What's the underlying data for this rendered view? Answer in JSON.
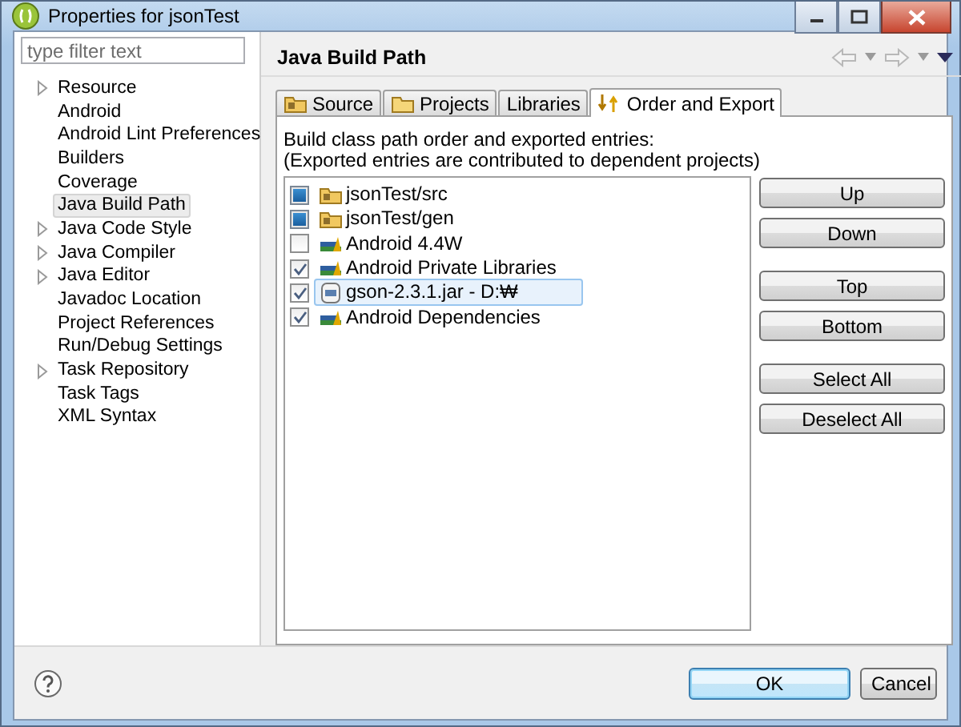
{
  "window": {
    "title": "Properties for jsonTest"
  },
  "filter": {
    "placeholder": "type filter text"
  },
  "tree": [
    {
      "label": "Resource",
      "has_children": true,
      "selected": false
    },
    {
      "label": "Android",
      "has_children": false,
      "selected": false
    },
    {
      "label": "Android Lint Preferences",
      "has_children": false,
      "selected": false
    },
    {
      "label": "Builders",
      "has_children": false,
      "selected": false
    },
    {
      "label": "Coverage",
      "has_children": false,
      "selected": false
    },
    {
      "label": "Java Build Path",
      "has_children": false,
      "selected": true
    },
    {
      "label": "Java Code Style",
      "has_children": true,
      "selected": false
    },
    {
      "label": "Java Compiler",
      "has_children": true,
      "selected": false
    },
    {
      "label": "Java Editor",
      "has_children": true,
      "selected": false
    },
    {
      "label": "Javadoc Location",
      "has_children": false,
      "selected": false
    },
    {
      "label": "Project References",
      "has_children": false,
      "selected": false
    },
    {
      "label": "Run/Debug Settings",
      "has_children": false,
      "selected": false
    },
    {
      "label": "Task Repository",
      "has_children": true,
      "selected": false
    },
    {
      "label": "Task Tags",
      "has_children": false,
      "selected": false
    },
    {
      "label": "XML Syntax",
      "has_children": false,
      "selected": false
    }
  ],
  "page": {
    "title": "Java Build Path"
  },
  "tabs": [
    {
      "label": "Source",
      "kind": "source",
      "selected": false
    },
    {
      "label": "Projects",
      "kind": "projects",
      "selected": false
    },
    {
      "label": "Libraries",
      "kind": "libraries",
      "selected": false
    },
    {
      "label": "Order and Export",
      "kind": "order",
      "selected": true
    }
  ],
  "description": [
    "Build class path order and exported entries:",
    "(Exported entries are contributed to dependent projects)"
  ],
  "entries": [
    {
      "label": "jsonTest/src",
      "kind": "source",
      "checked": true,
      "grayed": true,
      "selected": false
    },
    {
      "label": "jsonTest/gen",
      "kind": "source",
      "checked": true,
      "grayed": true,
      "selected": false
    },
    {
      "label": "Android 4.4W",
      "kind": "library",
      "checked": false,
      "grayed": false,
      "selected": false
    },
    {
      "label": "Android Private Libraries",
      "kind": "library",
      "checked": true,
      "grayed": false,
      "selected": false
    },
    {
      "label": "gson-2.3.1.jar - D:₩",
      "kind": "jar",
      "checked": true,
      "grayed": false,
      "selected": true
    },
    {
      "label": "Android Dependencies",
      "kind": "library",
      "checked": true,
      "grayed": false,
      "selected": false
    }
  ],
  "side_button_groups": [
    [
      "Up",
      "Down"
    ],
    [
      "Top",
      "Bottom"
    ],
    [
      "Select All",
      "Deselect All"
    ]
  ],
  "dialog_buttons": [
    {
      "label": "OK",
      "default": true
    },
    {
      "label": "Cancel",
      "default": false
    }
  ]
}
